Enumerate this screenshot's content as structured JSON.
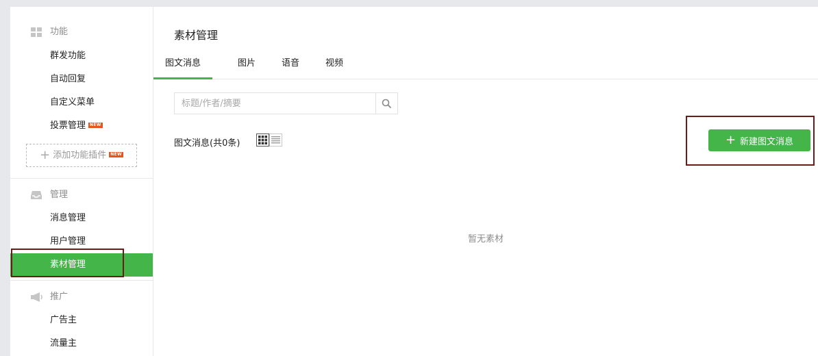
{
  "sidebar": {
    "sections": [
      {
        "title": "功能",
        "icon": "grid-icon"
      },
      {
        "title": "管理",
        "icon": "inbox-icon"
      },
      {
        "title": "推广",
        "icon": "megaphone-icon"
      }
    ],
    "function_items": [
      "群发功能",
      "自动回复",
      "自定义菜单",
      "投票管理"
    ],
    "new_tag": "NEW",
    "add_plugin_label": "添加功能插件",
    "manage_items": [
      "消息管理",
      "用户管理",
      "素材管理"
    ],
    "promo_items": [
      "广告主",
      "流量主"
    ],
    "active_item": "素材管理"
  },
  "main": {
    "title": "素材管理",
    "tabs": [
      "图文消息",
      "图片",
      "语音",
      "视频"
    ],
    "active_tab": "图文消息",
    "search_placeholder": "标题/作者/摘要",
    "search_value": "",
    "count_label": "图文消息(共0条)",
    "new_button_label": "新建图文消息",
    "empty_text": "暂无素材"
  },
  "colors": {
    "accent": "#44b549",
    "highlight_box": "#6a1b17",
    "new_tag": "#e8541e"
  }
}
